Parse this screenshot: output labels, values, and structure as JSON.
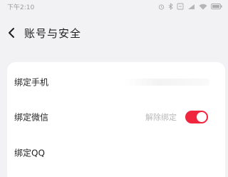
{
  "status_bar": {
    "time": "下午2:10",
    "icons": [
      "alarm-icon",
      "bluetooth-icon",
      "battery-saver-icon",
      "signal-icon",
      "wifi-icon",
      "battery-icon"
    ]
  },
  "header": {
    "back_icon": "chevron-left-icon",
    "title": "账号与安全"
  },
  "accounts": {
    "items": [
      {
        "label": "绑定手机",
        "value": ""
      },
      {
        "label": "绑定微信",
        "value": "解除绑定",
        "toggle_on": true
      },
      {
        "label": "绑定QQ",
        "value": ""
      }
    ]
  },
  "colors": {
    "background": "#f2f2f4",
    "card": "#ffffff",
    "accent": "#f0263f",
    "secondary_text": "#b8b8b8"
  }
}
